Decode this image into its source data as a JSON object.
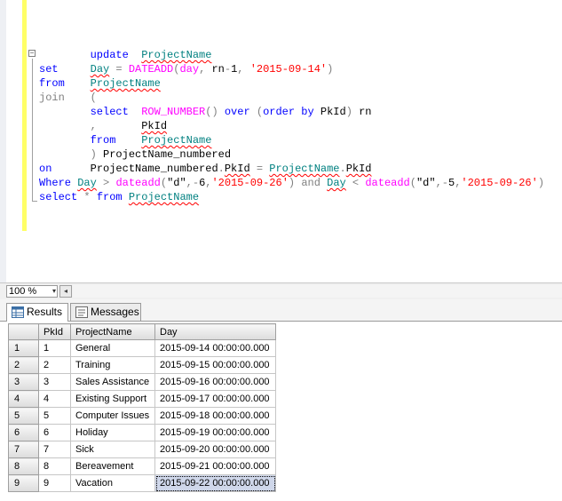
{
  "editor": {
    "collapse_glyph": "−",
    "lines": [
      [
        {
          "t": "        ",
          "c": "plain"
        },
        {
          "t": "update",
          "c": "kw"
        },
        {
          "t": "  ",
          "c": "plain"
        },
        {
          "t": "ProjectName",
          "c": "id",
          "sq": true
        }
      ],
      [
        {
          "t": "set",
          "c": "kw"
        },
        {
          "t": "     ",
          "c": "plain"
        },
        {
          "t": "Day",
          "c": "id",
          "sq": true
        },
        {
          "t": " = ",
          "c": "gray"
        },
        {
          "t": "DATEADD",
          "c": "fn"
        },
        {
          "t": "(",
          "c": "gray"
        },
        {
          "t": "day",
          "c": "fn"
        },
        {
          "t": ", ",
          "c": "gray"
        },
        {
          "t": "rn",
          "c": "plain"
        },
        {
          "t": "-",
          "c": "gray"
        },
        {
          "t": "1",
          "c": "plain"
        },
        {
          "t": ", ",
          "c": "gray"
        },
        {
          "t": "'2015-09-14'",
          "c": "str"
        },
        {
          "t": ")",
          "c": "gray"
        }
      ],
      [
        {
          "t": "from",
          "c": "kw"
        },
        {
          "t": "    ",
          "c": "plain"
        },
        {
          "t": "ProjectName",
          "c": "id",
          "sq": true
        }
      ],
      [
        {
          "t": "join",
          "c": "gray"
        },
        {
          "t": "    ",
          "c": "plain"
        },
        {
          "t": "(",
          "c": "gray"
        }
      ],
      [
        {
          "t": "        ",
          "c": "plain"
        },
        {
          "t": "select",
          "c": "kw"
        },
        {
          "t": "  ",
          "c": "plain"
        },
        {
          "t": "ROW_NUMBER",
          "c": "fn"
        },
        {
          "t": "() ",
          "c": "gray"
        },
        {
          "t": "over",
          "c": "kw"
        },
        {
          "t": " (",
          "c": "gray"
        },
        {
          "t": "order by",
          "c": "kw"
        },
        {
          "t": " PkId",
          "c": "plain"
        },
        {
          "t": ") ",
          "c": "gray"
        },
        {
          "t": "rn",
          "c": "plain"
        }
      ],
      [
        {
          "t": "        ",
          "c": "plain"
        },
        {
          "t": ",",
          "c": "gray"
        },
        {
          "t": "       ",
          "c": "plain"
        },
        {
          "t": "PkId",
          "c": "plain",
          "sq": true
        }
      ],
      [
        {
          "t": "        ",
          "c": "plain"
        },
        {
          "t": "from",
          "c": "kw"
        },
        {
          "t": "    ",
          "c": "plain"
        },
        {
          "t": "ProjectName",
          "c": "id",
          "sq": true
        }
      ],
      [
        {
          "t": "        ",
          "c": "plain"
        },
        {
          "t": ")",
          "c": "gray"
        },
        {
          "t": " ProjectName_numbered",
          "c": "plain"
        }
      ],
      [
        {
          "t": "on",
          "c": "kw"
        },
        {
          "t": "      ",
          "c": "plain"
        },
        {
          "t": "ProjectName_numbered",
          "c": "plain"
        },
        {
          "t": ".",
          "c": "gray"
        },
        {
          "t": "PkId",
          "c": "plain",
          "sq": true
        },
        {
          "t": " = ",
          "c": "gray"
        },
        {
          "t": "ProjectName",
          "c": "id",
          "sq": true
        },
        {
          "t": ".",
          "c": "gray"
        },
        {
          "t": "PkId",
          "c": "plain",
          "sq": true
        }
      ],
      [
        {
          "t": "Where",
          "c": "kw"
        },
        {
          "t": " ",
          "c": "plain"
        },
        {
          "t": "Day",
          "c": "id",
          "sq": true
        },
        {
          "t": " > ",
          "c": "gray"
        },
        {
          "t": "dateadd",
          "c": "fn"
        },
        {
          "t": "(",
          "c": "gray"
        },
        {
          "t": "\"d\"",
          "c": "plain"
        },
        {
          "t": ",",
          "c": "gray"
        },
        {
          "t": "-",
          "c": "gray"
        },
        {
          "t": "6",
          "c": "plain"
        },
        {
          "t": ",",
          "c": "gray"
        },
        {
          "t": "'2015-09-26'",
          "c": "str"
        },
        {
          "t": ") ",
          "c": "gray"
        },
        {
          "t": "and",
          "c": "gray"
        },
        {
          "t": " ",
          "c": "plain"
        },
        {
          "t": "Day",
          "c": "id",
          "sq": true
        },
        {
          "t": " < ",
          "c": "gray"
        },
        {
          "t": "dateadd",
          "c": "fn"
        },
        {
          "t": "(",
          "c": "gray"
        },
        {
          "t": "\"d\"",
          "c": "plain"
        },
        {
          "t": ",",
          "c": "gray"
        },
        {
          "t": "-",
          "c": "gray"
        },
        {
          "t": "5",
          "c": "plain"
        },
        {
          "t": ",",
          "c": "gray"
        },
        {
          "t": "'2015-09-26'",
          "c": "str"
        },
        {
          "t": ")",
          "c": "gray"
        }
      ],
      [
        {
          "t": "select",
          "c": "kw"
        },
        {
          "t": " * ",
          "c": "gray"
        },
        {
          "t": "from",
          "c": "kw"
        },
        {
          "t": " ",
          "c": "plain"
        },
        {
          "t": "ProjectName",
          "c": "id",
          "sq": true
        }
      ]
    ]
  },
  "zoom": {
    "value": "100 %",
    "arrow": "▾",
    "scroll_left": "◂"
  },
  "tabs": {
    "results": "Results",
    "messages": "Messages"
  },
  "grid": {
    "columns": [
      "PkId",
      "ProjectName",
      "Day"
    ],
    "rows": [
      [
        "1",
        "1",
        "General",
        "2015-09-14 00:00:00.000"
      ],
      [
        "2",
        "2",
        "Training",
        "2015-09-15 00:00:00.000"
      ],
      [
        "3",
        "3",
        "Sales Assistance",
        "2015-09-16 00:00:00.000"
      ],
      [
        "4",
        "4",
        "Existing Support",
        "2015-09-17 00:00:00.000"
      ],
      [
        "5",
        "5",
        "Computer Issues",
        "2015-09-18 00:00:00.000"
      ],
      [
        "6",
        "6",
        "Holiday",
        "2015-09-19 00:00:00.000"
      ],
      [
        "7",
        "7",
        "Sick",
        "2015-09-20 00:00:00.000"
      ],
      [
        "8",
        "8",
        "Bereavement",
        "2015-09-21 00:00:00.000"
      ],
      [
        "9",
        "9",
        "Vacation",
        "2015-09-22 00:00:00.000"
      ]
    ],
    "selected_row": 8
  },
  "colors": {
    "keyword": "#0000ff",
    "function": "#ff00ff",
    "string": "#ff0000",
    "identifier": "#008080",
    "operator": "#808080",
    "change_bar": "#ffff66",
    "selection": "#cfd7ea"
  }
}
